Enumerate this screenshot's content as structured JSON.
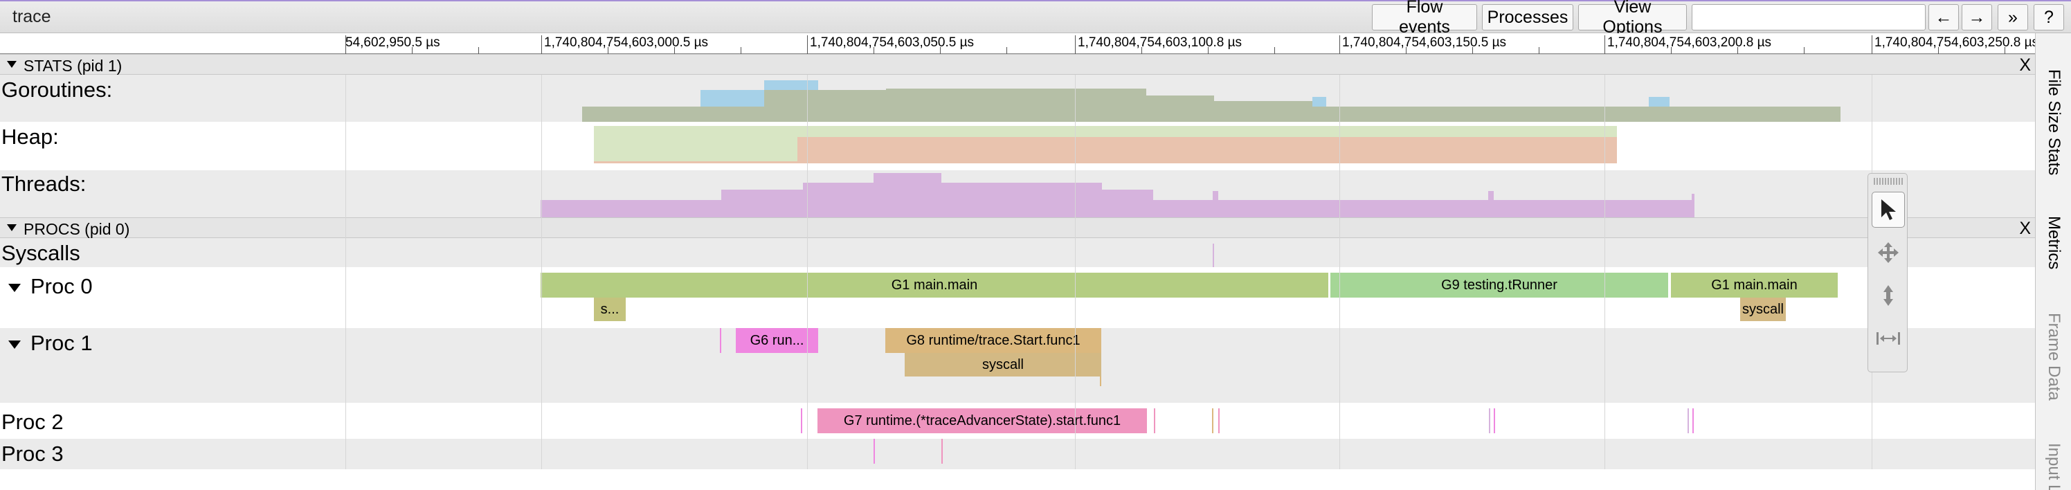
{
  "app": {
    "title": "trace"
  },
  "toolbar": {
    "flow_events": "Flow events",
    "processes": "Processes",
    "view_options": "View Options",
    "search_value": "",
    "prev": "←",
    "next": "→",
    "more": "»",
    "help": "?"
  },
  "ruler": {
    "labels": [
      "54,602,950.5 µs",
      "1,740,804,754,603,000.5 µs",
      "1,740,804,754,603,050.5 µs",
      "1,740,804,754,603,100.8 µs",
      "1,740,804,754,603,150.5 µs",
      "1,740,804,754,603,200.8 µs",
      "1,740,804,754,603,250.8 µs"
    ]
  },
  "stats": {
    "title": "STATS (pid 1)",
    "close": "X",
    "tracks": {
      "goroutines": "Goroutines:",
      "heap": "Heap:",
      "threads": "Threads:"
    }
  },
  "procs": {
    "title": "PROCS (pid 0)",
    "close": "X",
    "syscalls": "Syscalls",
    "proc0": {
      "label": "Proc 0",
      "slices": [
        "G1 main.main",
        "G9 testing.tRunner",
        "G1 main.main"
      ],
      "sub": [
        "s...",
        "syscall"
      ]
    },
    "proc1": {
      "label": "Proc 1",
      "slices": [
        "G6 run...",
        "G8 runtime/trace.Start.func1"
      ],
      "sub": [
        "syscall"
      ]
    },
    "proc2": {
      "label": "Proc 2",
      "slices": [
        "G7 runtime.(*traceAdvancerState).start.func1"
      ]
    },
    "proc3": {
      "label": "Proc 3"
    }
  },
  "side_tabs": [
    "File Size Stats",
    "Metrics",
    "Frame Data",
    "Input L"
  ],
  "colors": {
    "g1": "#b4cd82",
    "g9": "#a5d696",
    "g8": "#dbb87e",
    "g6": "#ef87e0",
    "g7": "#ef95bf",
    "syscall": "#d3b984",
    "goroutines_a": "#b5bfa6",
    "goroutines_b": "#a6d1e8",
    "heap_a": "#d8e6c4",
    "heap_b": "#e9c3ae",
    "threads": "#d6b3dd"
  }
}
